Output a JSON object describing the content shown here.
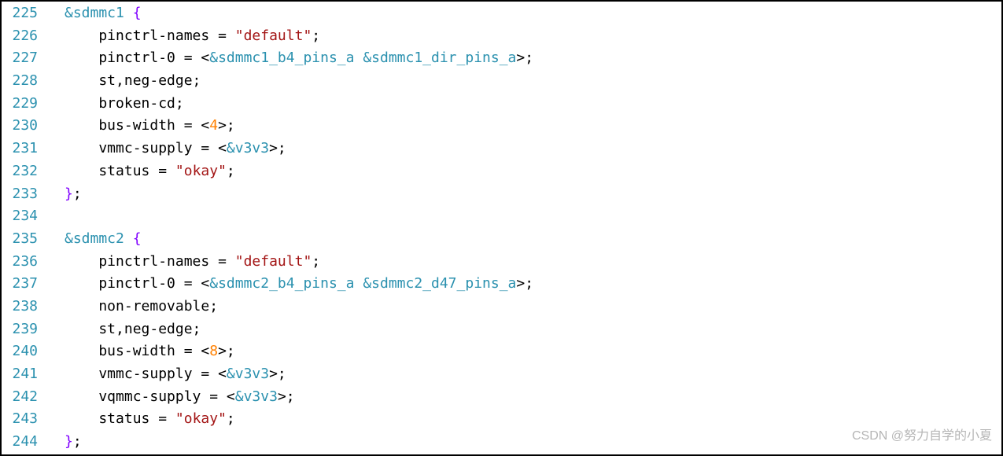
{
  "watermark": "CSDN @努力自学的小夏",
  "lines": [
    {
      "num": "225",
      "tokens": [
        {
          "t": "&sdmmc1",
          "c": "ref"
        },
        {
          "t": " ",
          "c": "plain"
        },
        {
          "t": "{",
          "c": "brace"
        }
      ]
    },
    {
      "num": "226",
      "tokens": [
        {
          "t": "    pinctrl-names = ",
          "c": "plain"
        },
        {
          "t": "\"default\"",
          "c": "str"
        },
        {
          "t": ";",
          "c": "plain"
        }
      ]
    },
    {
      "num": "227",
      "tokens": [
        {
          "t": "    pinctrl-0 = <",
          "c": "plain"
        },
        {
          "t": "&sdmmc1_b4_pins_a",
          "c": "ref"
        },
        {
          "t": " ",
          "c": "plain"
        },
        {
          "t": "&sdmmc1_dir_pins_a",
          "c": "ref"
        },
        {
          "t": ">;",
          "c": "plain"
        }
      ]
    },
    {
      "num": "228",
      "tokens": [
        {
          "t": "    st,neg-edge;",
          "c": "plain"
        }
      ]
    },
    {
      "num": "229",
      "tokens": [
        {
          "t": "    broken-cd;",
          "c": "plain"
        }
      ]
    },
    {
      "num": "230",
      "tokens": [
        {
          "t": "    bus-width = <",
          "c": "plain"
        },
        {
          "t": "4",
          "c": "num"
        },
        {
          "t": ">;",
          "c": "plain"
        }
      ]
    },
    {
      "num": "231",
      "tokens": [
        {
          "t": "    vmmc-supply = <",
          "c": "plain"
        },
        {
          "t": "&v3v3",
          "c": "ref"
        },
        {
          "t": ">;",
          "c": "plain"
        }
      ]
    },
    {
      "num": "232",
      "tokens": [
        {
          "t": "    status = ",
          "c": "plain"
        },
        {
          "t": "\"okay\"",
          "c": "str"
        },
        {
          "t": ";",
          "c": "plain"
        }
      ]
    },
    {
      "num": "233",
      "tokens": [
        {
          "t": "}",
          "c": "brace"
        },
        {
          "t": ";",
          "c": "plain"
        }
      ]
    },
    {
      "num": "234",
      "tokens": []
    },
    {
      "num": "235",
      "tokens": [
        {
          "t": "&sdmmc2",
          "c": "ref"
        },
        {
          "t": " ",
          "c": "plain"
        },
        {
          "t": "{",
          "c": "brace"
        }
      ]
    },
    {
      "num": "236",
      "tokens": [
        {
          "t": "    pinctrl-names = ",
          "c": "plain"
        },
        {
          "t": "\"default\"",
          "c": "str"
        },
        {
          "t": ";",
          "c": "plain"
        }
      ]
    },
    {
      "num": "237",
      "tokens": [
        {
          "t": "    pinctrl-0 = <",
          "c": "plain"
        },
        {
          "t": "&sdmmc2_b4_pins_a",
          "c": "ref"
        },
        {
          "t": " ",
          "c": "plain"
        },
        {
          "t": "&sdmmc2_d47_pins_a",
          "c": "ref"
        },
        {
          "t": ">;",
          "c": "plain"
        }
      ]
    },
    {
      "num": "238",
      "tokens": [
        {
          "t": "    non-removable;",
          "c": "plain"
        }
      ]
    },
    {
      "num": "239",
      "tokens": [
        {
          "t": "    st,neg-edge;",
          "c": "plain"
        }
      ]
    },
    {
      "num": "240",
      "tokens": [
        {
          "t": "    bus-width = <",
          "c": "plain"
        },
        {
          "t": "8",
          "c": "num"
        },
        {
          "t": ">;",
          "c": "plain"
        }
      ]
    },
    {
      "num": "241",
      "tokens": [
        {
          "t": "    vmmc-supply = <",
          "c": "plain"
        },
        {
          "t": "&v3v3",
          "c": "ref"
        },
        {
          "t": ">;",
          "c": "plain"
        }
      ]
    },
    {
      "num": "242",
      "tokens": [
        {
          "t": "    vqmmc-supply = <",
          "c": "plain"
        },
        {
          "t": "&v3v3",
          "c": "ref"
        },
        {
          "t": ">;",
          "c": "plain"
        }
      ]
    },
    {
      "num": "243",
      "tokens": [
        {
          "t": "    status = ",
          "c": "plain"
        },
        {
          "t": "\"okay\"",
          "c": "str"
        },
        {
          "t": ";",
          "c": "plain"
        }
      ]
    },
    {
      "num": "244",
      "tokens": [
        {
          "t": "}",
          "c": "brace"
        },
        {
          "t": ";",
          "c": "plain"
        }
      ]
    }
  ]
}
